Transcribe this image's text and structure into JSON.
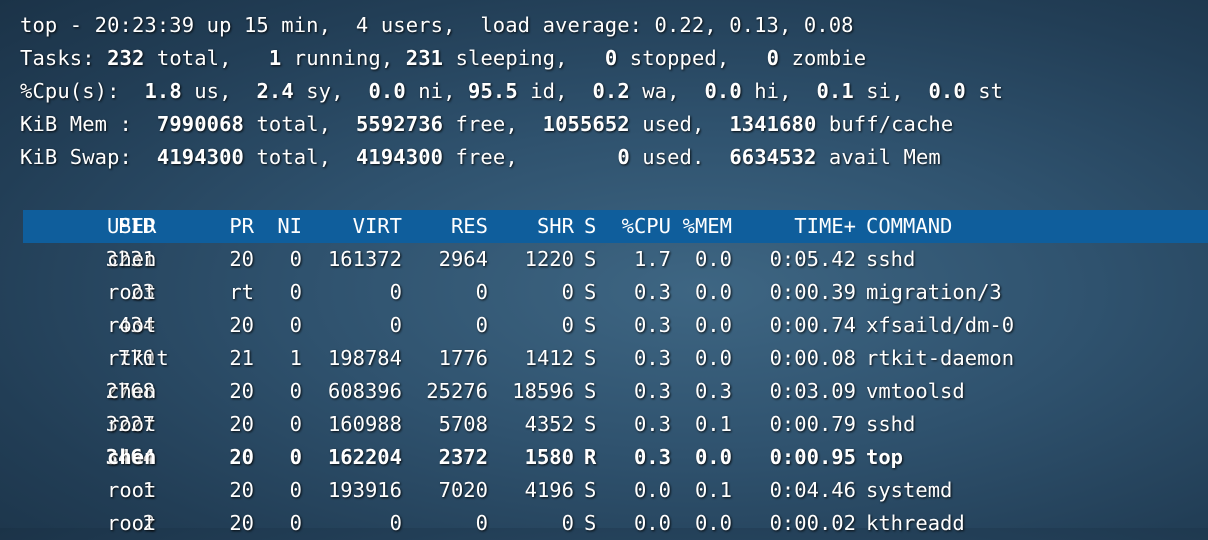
{
  "summary": {
    "line1": "top - 20:23:39 up 15 min,  4 users,  load average: 0.22, 0.13, 0.08",
    "tasks": {
      "label": "Tasks:",
      "total": "232",
      "total_label": "total,",
      "running": "1",
      "running_label": "running,",
      "sleeping": "231",
      "sleeping_label": "sleeping,",
      "stopped": "0",
      "stopped_label": "stopped,",
      "zombie": "0",
      "zombie_label": "zombie"
    },
    "cpu": {
      "label": "%Cpu(s):",
      "us": "1.8",
      "us_label": "us,",
      "sy": "2.4",
      "sy_label": "sy,",
      "ni": "0.0",
      "ni_label": "ni,",
      "id": "95.5",
      "id_label": "id,",
      "wa": "0.2",
      "wa_label": "wa,",
      "hi": "0.0",
      "hi_label": "hi,",
      "si": "0.1",
      "si_label": "si,",
      "st": "0.0",
      "st_label": "st"
    },
    "mem": {
      "label": "KiB Mem :",
      "total": "7990068",
      "total_label": "total,",
      "free": "5592736",
      "free_label": "free,",
      "used": "1055652",
      "used_label": "used,",
      "cache": "1341680",
      "cache_label": "buff/cache"
    },
    "swap": {
      "label": "KiB Swap:",
      "total": "4194300",
      "total_label": "total,",
      "free": "4194300",
      "free_label": "free,",
      "used": "0",
      "used_label": "used.",
      "avail": "6634532",
      "avail_label": "avail Mem"
    }
  },
  "columns": [
    "PID",
    "USER",
    "PR",
    "NI",
    "VIRT",
    "RES",
    "SHR",
    "S",
    "%CPU",
    "%MEM",
    "TIME+",
    "COMMAND"
  ],
  "processes": [
    {
      "pid": "3231",
      "user": "chen",
      "pr": "20",
      "ni": "0",
      "virt": "161372",
      "res": "2964",
      "shr": "1220",
      "s": "S",
      "cpu": "1.7",
      "mem": "0.0",
      "time": "0:05.42",
      "command": "sshd",
      "bold": false
    },
    {
      "pid": "23",
      "user": "root",
      "pr": "rt",
      "ni": "0",
      "virt": "0",
      "res": "0",
      "shr": "0",
      "s": "S",
      "cpu": "0.3",
      "mem": "0.0",
      "time": "0:00.39",
      "command": "migration/3",
      "bold": false
    },
    {
      "pid": "434",
      "user": "root",
      "pr": "20",
      "ni": "0",
      "virt": "0",
      "res": "0",
      "shr": "0",
      "s": "S",
      "cpu": "0.3",
      "mem": "0.0",
      "time": "0:00.74",
      "command": "xfsaild/dm-0",
      "bold": false
    },
    {
      "pid": "770",
      "user": "rtkit",
      "pr": "21",
      "ni": "1",
      "virt": "198784",
      "res": "1776",
      "shr": "1412",
      "s": "S",
      "cpu": "0.3",
      "mem": "0.0",
      "time": "0:00.08",
      "command": "rtkit-daemon",
      "bold": false
    },
    {
      "pid": "2768",
      "user": "chen",
      "pr": "20",
      "ni": "0",
      "virt": "608396",
      "res": "25276",
      "shr": "18596",
      "s": "S",
      "cpu": "0.3",
      "mem": "0.3",
      "time": "0:03.09",
      "command": "vmtoolsd",
      "bold": false
    },
    {
      "pid": "3227",
      "user": "root",
      "pr": "20",
      "ni": "0",
      "virt": "160988",
      "res": "5708",
      "shr": "4352",
      "s": "S",
      "cpu": "0.3",
      "mem": "0.1",
      "time": "0:00.79",
      "command": "sshd",
      "bold": false
    },
    {
      "pid": "3464",
      "user": "chen",
      "pr": "20",
      "ni": "0",
      "virt": "162204",
      "res": "2372",
      "shr": "1580",
      "s": "R",
      "cpu": "0.3",
      "mem": "0.0",
      "time": "0:00.95",
      "command": "top",
      "bold": true
    },
    {
      "pid": "1",
      "user": "root",
      "pr": "20",
      "ni": "0",
      "virt": "193916",
      "res": "7020",
      "shr": "4196",
      "s": "S",
      "cpu": "0.0",
      "mem": "0.1",
      "time": "0:04.46",
      "command": "systemd",
      "bold": false
    },
    {
      "pid": "2",
      "user": "root",
      "pr": "20",
      "ni": "0",
      "virt": "0",
      "res": "0",
      "shr": "0",
      "s": "S",
      "cpu": "0.0",
      "mem": "0.0",
      "time": "0:00.02",
      "command": "kthreadd",
      "bold": false
    }
  ],
  "colors": {
    "header_bg": "#0f5e9c",
    "text": "#ffffff",
    "background": "#2f526e"
  }
}
